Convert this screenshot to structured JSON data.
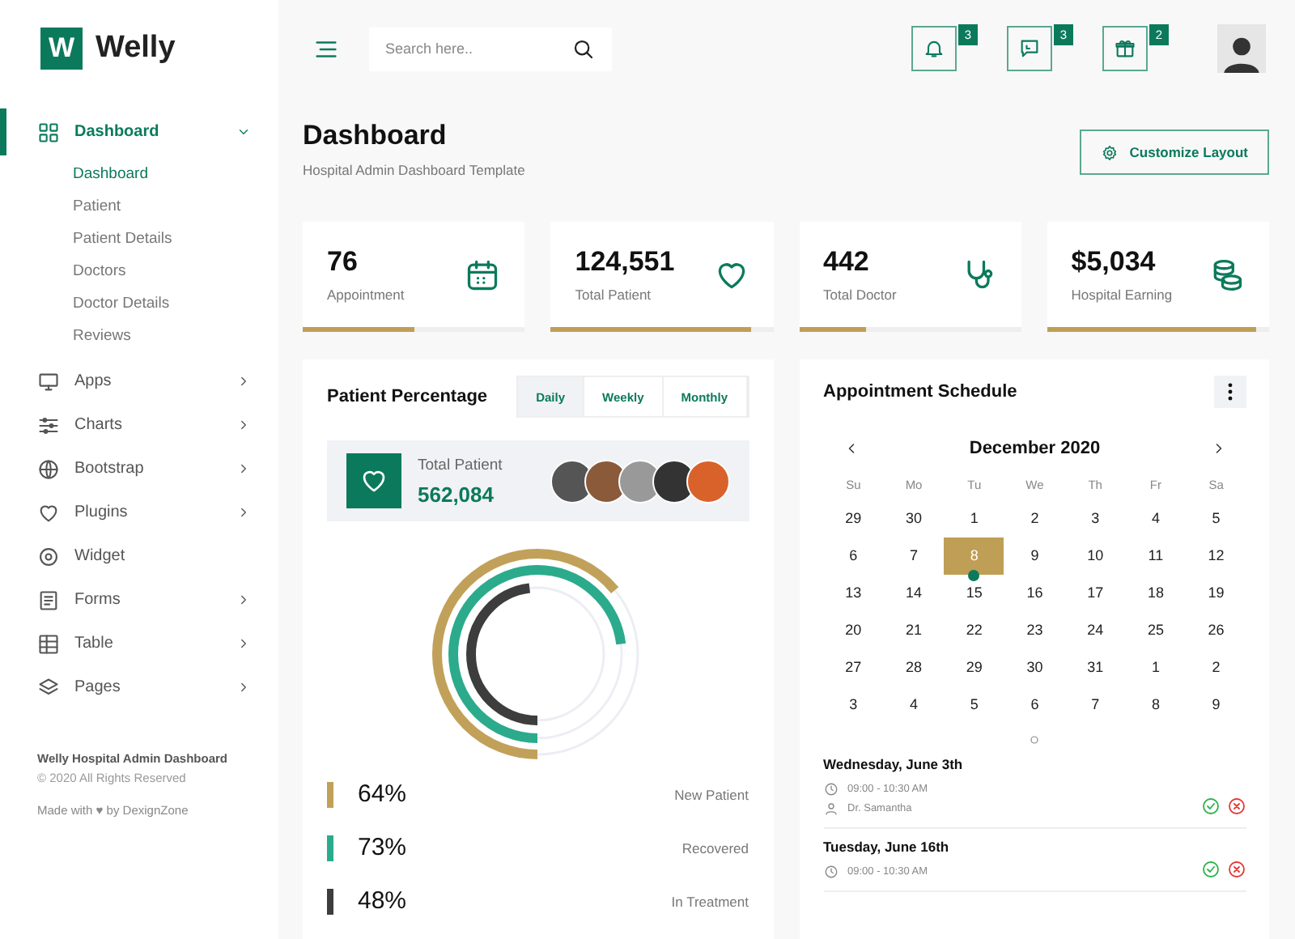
{
  "brand": {
    "logo_letter": "W",
    "name": "Welly"
  },
  "sidebar": {
    "items": [
      {
        "label": "Dashboard",
        "kind": "group",
        "selected": true,
        "expanded": true,
        "children": [
          {
            "label": "Dashboard",
            "selected": true
          },
          {
            "label": "Patient",
            "selected": false
          },
          {
            "label": "Patient Details",
            "selected": false
          },
          {
            "label": "Doctors",
            "selected": false
          },
          {
            "label": "Doctor Details",
            "selected": false
          },
          {
            "label": "Reviews",
            "selected": false
          }
        ]
      },
      {
        "label": "Apps",
        "kind": "group",
        "selected": false,
        "expanded": false
      },
      {
        "label": "Charts",
        "kind": "group",
        "selected": false,
        "expanded": false
      },
      {
        "label": "Bootstrap",
        "kind": "group",
        "selected": false,
        "expanded": false
      },
      {
        "label": "Plugins",
        "kind": "group",
        "selected": false,
        "expanded": false
      },
      {
        "label": "Widget",
        "kind": "link",
        "selected": false
      },
      {
        "label": "Forms",
        "kind": "group",
        "selected": false,
        "expanded": false
      },
      {
        "label": "Table",
        "kind": "group",
        "selected": false,
        "expanded": false
      },
      {
        "label": "Pages",
        "kind": "group",
        "selected": false,
        "expanded": false
      }
    ],
    "footer": {
      "title": "Welly Hospital Admin Dashboard",
      "copyright": "© 2020 All Rights Reserved",
      "credit": "Made with ♥ by DexignZone"
    }
  },
  "topbar": {
    "search": {
      "placeholder": "Search here.."
    },
    "notifications": [
      {
        "count": "3"
      },
      {
        "count": "3"
      },
      {
        "count": "2"
      }
    ]
  },
  "page": {
    "title": "Dashboard",
    "subtitle": "Hospital Admin Dashboard Template",
    "action": "Customize Layout"
  },
  "stats": [
    {
      "value": "76",
      "label": "Appointment",
      "level": 0.5
    },
    {
      "value": "124,551",
      "label": "Total Patient",
      "level": 0.9
    },
    {
      "value": "442",
      "label": "Total Doctor",
      "level": 0.3
    },
    {
      "value": "$5,034",
      "label": "Hospital Earning",
      "level": 0.94
    }
  ],
  "patient_panel": {
    "title": "Patient Percentage",
    "tabs": [
      {
        "label": "Daily",
        "selected": true
      },
      {
        "label": "Weekly",
        "selected": false
      },
      {
        "label": "Monthly",
        "selected": false
      }
    ],
    "total": {
      "label": "Total Patient",
      "value": "562,084"
    },
    "legend": [
      {
        "value": "64%",
        "label": "New Patient",
        "level": 0.64,
        "color": "#c1a15a"
      },
      {
        "value": "73%",
        "label": "Recovered",
        "level": 0.73,
        "color": "#2bab8c"
      },
      {
        "value": "48%",
        "label": "In Treatment",
        "level": 0.48,
        "color": "#3d3d3d"
      }
    ]
  },
  "schedule": {
    "title": "Appointment Schedule",
    "calendar": {
      "month": "December 2020",
      "weekdays": [
        "Su",
        "Mo",
        "Tu",
        "We",
        "Th",
        "Fr",
        "Sa"
      ],
      "weeks": [
        [
          {
            "day": "29",
            "selected": false,
            "event": false
          },
          {
            "day": "30",
            "selected": false,
            "event": false
          },
          {
            "day": "1",
            "selected": false,
            "event": false
          },
          {
            "day": "2",
            "selected": false,
            "event": false
          },
          {
            "day": "3",
            "selected": false,
            "event": false
          },
          {
            "day": "4",
            "selected": false,
            "event": false
          },
          {
            "day": "5",
            "selected": false,
            "event": false
          }
        ],
        [
          {
            "day": "6",
            "selected": false,
            "event": false
          },
          {
            "day": "7",
            "selected": false,
            "event": false
          },
          {
            "day": "8",
            "selected": true,
            "event": true
          },
          {
            "day": "9",
            "selected": false,
            "event": false
          },
          {
            "day": "10",
            "selected": false,
            "event": false
          },
          {
            "day": "11",
            "selected": false,
            "event": false
          },
          {
            "day": "12",
            "selected": false,
            "event": false
          }
        ],
        [
          {
            "day": "13",
            "selected": false,
            "event": false
          },
          {
            "day": "14",
            "selected": false,
            "event": false
          },
          {
            "day": "15",
            "selected": false,
            "event": false
          },
          {
            "day": "16",
            "selected": false,
            "event": false
          },
          {
            "day": "17",
            "selected": false,
            "event": false
          },
          {
            "day": "18",
            "selected": false,
            "event": false
          },
          {
            "day": "19",
            "selected": false,
            "event": false
          }
        ],
        [
          {
            "day": "20",
            "selected": false,
            "event": false
          },
          {
            "day": "21",
            "selected": false,
            "event": false
          },
          {
            "day": "22",
            "selected": false,
            "event": false
          },
          {
            "day": "23",
            "selected": false,
            "event": false
          },
          {
            "day": "24",
            "selected": false,
            "event": false
          },
          {
            "day": "25",
            "selected": false,
            "event": false
          },
          {
            "day": "26",
            "selected": false,
            "event": false
          }
        ],
        [
          {
            "day": "27",
            "selected": false,
            "event": false
          },
          {
            "day": "28",
            "selected": false,
            "event": false
          },
          {
            "day": "29",
            "selected": false,
            "event": false
          },
          {
            "day": "30",
            "selected": false,
            "event": false
          },
          {
            "day": "31",
            "selected": false,
            "event": false
          },
          {
            "day": "1",
            "selected": false,
            "event": false
          },
          {
            "day": "2",
            "selected": false,
            "event": false
          }
        ],
        [
          {
            "day": "3",
            "selected": false,
            "event": false
          },
          {
            "day": "4",
            "selected": false,
            "event": false
          },
          {
            "day": "5",
            "selected": false,
            "event": false
          },
          {
            "day": "6",
            "selected": false,
            "event": false
          },
          {
            "day": "7",
            "selected": false,
            "event": false
          },
          {
            "day": "8",
            "selected": false,
            "event": false
          },
          {
            "day": "9",
            "selected": false,
            "event": false
          }
        ]
      ]
    },
    "appointments": [
      {
        "date": "Wednesday, June 3th",
        "time": "09:00 - 10:30 AM",
        "doctor": "Dr. Samantha"
      },
      {
        "date": "Tuesday, June 16th",
        "time": "09:00 - 10:30 AM"
      }
    ]
  }
}
